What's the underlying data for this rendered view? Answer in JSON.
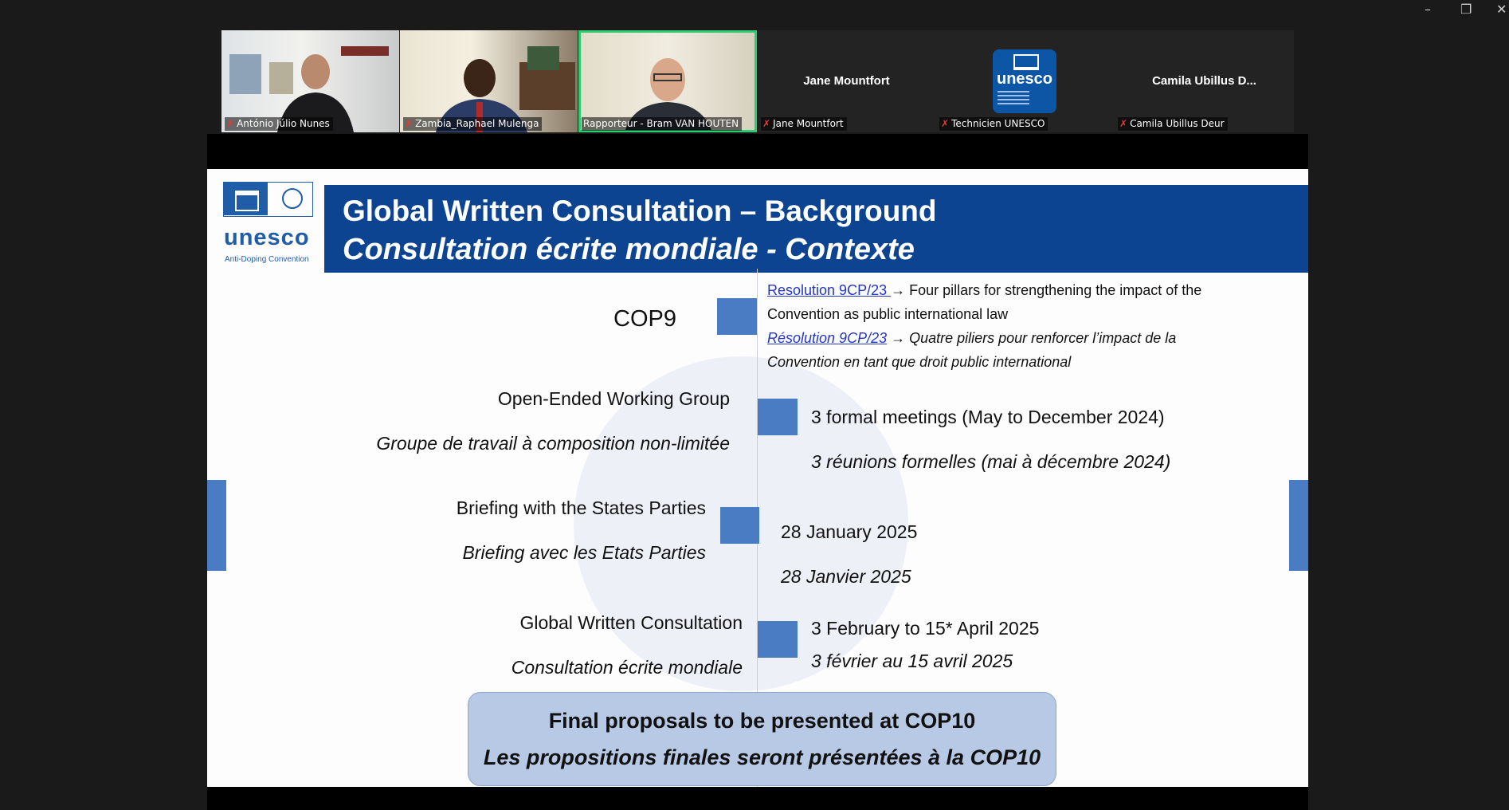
{
  "window_controls": {
    "minimize": "–",
    "restore": "❐",
    "close": "✕"
  },
  "participants": [
    {
      "label": "António Júlio Nunes",
      "kind": "video"
    },
    {
      "label": "Zambia_Raphael Mulenga",
      "kind": "video"
    },
    {
      "label": "Rapporteur - Bram VAN HOUTEN",
      "kind": "video",
      "speaking": true
    },
    {
      "label": "Jane Mountfort",
      "display_name": "Jane Mountfort",
      "kind": "name"
    },
    {
      "label": "Technicien UNESCO",
      "kind": "logo",
      "logo_text": "unesco"
    },
    {
      "label": "Camila Ubillus Deur",
      "display_name": "Camila  Ubillus  D...",
      "kind": "name"
    }
  ],
  "slide": {
    "title_en": "Global Written Consultation – Background",
    "title_fr": "Consultation écrite mondiale - Contexte",
    "logo": {
      "word": "unesco",
      "subtitle": "Anti-Doping Convention"
    },
    "rows": [
      {
        "left_en": "COP9"
      },
      {
        "right_en_link": "Resolution 9CP/23 ",
        "right_en_text": "→ Four pillars for strengthening the impact of the",
        "right_en_text2": "Convention as public international law",
        "right_fr_link": "Résolution 9CP/23",
        "right_fr_text": " →  Quatre piliers pour renforcer l’impact de la",
        "right_fr_text2": "Convention en tant que droit public  international"
      },
      {
        "left_en": "Open-Ended Working Group",
        "left_fr": "Groupe de travail à composition non-limitée",
        "right_en": "3 formal meetings (May to December 2024)",
        "right_fr": "3 réunions formelles (mai à décembre 2024)"
      },
      {
        "left_en": "Briefing with the States Parties",
        "left_fr": "Briefing avec les Etats Parties",
        "right_en": "28 January 2025",
        "right_fr": "28 Janvier 2025"
      },
      {
        "left_en": "Global Written Consultation",
        "left_fr": "Consultation écrite mondiale",
        "right_en": "3 February to 15* April 2025",
        "right_fr": "3 février au 15 avril 2025"
      }
    ],
    "final_box": {
      "en": "Final proposals to be presented at COP10",
      "fr": "Les propositions finales seront présentées à la COP10"
    },
    "colors": {
      "header": "#0d4492",
      "accent": "#4a7cc4",
      "final_box": "#b7c9e5",
      "link": "#2437c4",
      "speaking": "#2ecc71"
    }
  }
}
